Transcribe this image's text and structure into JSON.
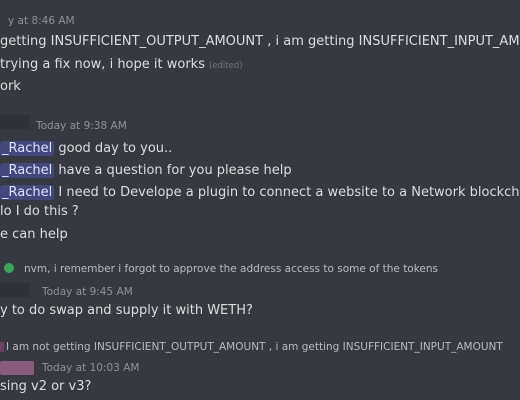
{
  "colors": {
    "background": "#36393f",
    "text": "#dcddde",
    "timestamp": "#8e9297",
    "mention_bg": "#4c5589",
    "reply_green": "#3ba55c",
    "reply_pink": "#b36b9e"
  },
  "messages": {
    "m1": {
      "timestamp": "y at 8:46 AM",
      "lines": [
        "getting INSUFFICIENT_OUTPUT_AMOUNT , i am getting INSUFFICIENT_INPUT_AMOUN",
        "trying a fix now, i hope it works",
        "ork"
      ],
      "edited": "(edited)"
    },
    "m2": {
      "timestamp": "Today at 9:38 AM",
      "mention": "_Rachel",
      "lines": [
        "good day to you..",
        "have a question for you please help",
        "I need to Develope a plugin to connect a website to a Network blockchain trough",
        "lo I do this ?",
        "e can help"
      ]
    },
    "m3": {
      "reply_preview": "nvm, i remember i forgot to approve the address access to some of the tokens",
      "timestamp": "Today at 9:45 AM",
      "lines": [
        "y to do swap and supply it with WETH?"
      ]
    },
    "m4": {
      "reply_preview": "I am not getting INSUFFICIENT_OUTPUT_AMOUNT , i am getting INSUFFICIENT_INPUT_AMOUNT",
      "timestamp": "Today at 10:03 AM",
      "lines": [
        "sing v2 or v3?"
      ]
    }
  }
}
